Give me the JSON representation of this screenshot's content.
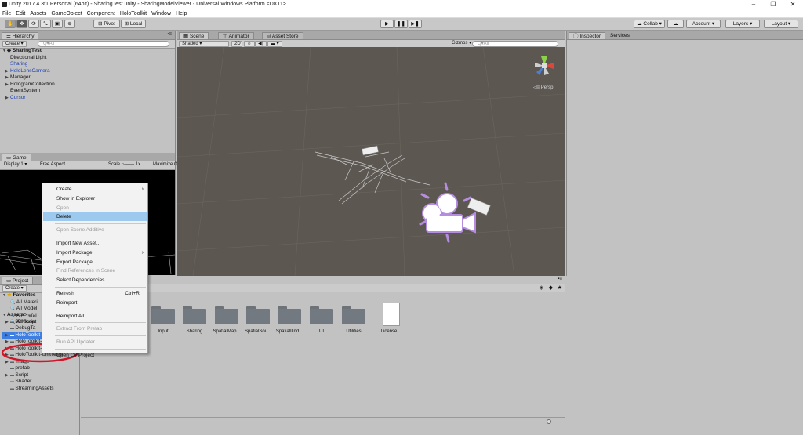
{
  "window": {
    "title": "Unity 2017.4.3f1 Personal (64bit) - SharingTest.unity - SharingModelViewer - Universal Windows Platform <DX11>",
    "controls": [
      "–",
      "❐",
      "✕"
    ]
  },
  "menubar": [
    "File",
    "Edit",
    "Assets",
    "GameObject",
    "Component",
    "HoloToolkit",
    "Window",
    "Help"
  ],
  "toolbar": {
    "pivot": "Pivot",
    "local": "Local",
    "collab": "Collab",
    "account": "Account",
    "layers": "Layers",
    "layout": "Layout"
  },
  "hierarchy": {
    "tab": "Hierarchy",
    "create": "Create",
    "search_placeholder": "Q▾All",
    "scene": "SharingTest",
    "items": [
      {
        "label": "Directional Light",
        "blue": false,
        "arrow": false
      },
      {
        "label": "Sharing",
        "blue": true,
        "arrow": false
      },
      {
        "label": "HoloLensCamera",
        "blue": true,
        "arrow": true
      },
      {
        "label": "Manager",
        "blue": false,
        "arrow": true
      },
      {
        "label": "HologramCollection",
        "blue": false,
        "arrow": true
      },
      {
        "label": "EventSystem",
        "blue": false,
        "arrow": false
      },
      {
        "label": "Cursor",
        "blue": true,
        "arrow": true
      }
    ]
  },
  "game": {
    "tab": "Game",
    "display": "Display 1",
    "aspect": "Free Aspect",
    "scale_label": "Scale",
    "scale_value": "1x",
    "maximize": "Maximize O"
  },
  "scene": {
    "tabs": [
      "Scene",
      "Animator",
      "Asset Store"
    ],
    "shaded": "Shaded",
    "mode_2d": "2D",
    "gizmos": "Gizmos",
    "search_placeholder": "Q▾All",
    "persp": "Persp"
  },
  "inspector": {
    "tabs": [
      "Inspector",
      "Services"
    ]
  },
  "project": {
    "tab": "Project",
    "create": "Create",
    "favorites_label": "Favorites",
    "favorites": [
      "All Materi",
      "All Model",
      "All Prefal",
      "All Script"
    ],
    "assets_label": "Assets",
    "assets": [
      {
        "label": "3DModel",
        "arrow": true
      },
      {
        "label": "DebugTa",
        "arrow": false
      },
      {
        "label": "HoloToolkit",
        "arrow": true,
        "selected": true
      },
      {
        "label": "HoloToolkit-Examples",
        "arrow": true
      },
      {
        "label": "HoloToolkit-Tests",
        "arrow": true
      },
      {
        "label": "HoloToolkit-UnitTests",
        "arrow": true
      },
      {
        "label": "Image",
        "arrow": true
      },
      {
        "label": "prefab",
        "arrow": false
      },
      {
        "label": "Script",
        "arrow": true
      },
      {
        "label": "Shader",
        "arrow": false
      },
      {
        "label": "StreamingAssets",
        "arrow": false
      }
    ],
    "grid_items": [
      "Input",
      "Sharing",
      "SpatialMap...",
      "SpatialSou...",
      "SpatialUnd...",
      "UI",
      "Utilities",
      "License"
    ]
  },
  "context_menu": {
    "items": [
      {
        "label": "Create",
        "submenu": true
      },
      {
        "label": "Show in Explorer"
      },
      {
        "label": "Open",
        "disabled": true
      },
      {
        "label": "Delete",
        "highlighted": true
      },
      {
        "sep": true
      },
      {
        "label": "Open Scene Additive",
        "disabled": true
      },
      {
        "sep": true
      },
      {
        "label": "Import New Asset..."
      },
      {
        "label": "Import Package",
        "submenu": true
      },
      {
        "label": "Export Package..."
      },
      {
        "label": "Find References In Scene",
        "disabled": true
      },
      {
        "label": "Select Dependencies"
      },
      {
        "sep": true
      },
      {
        "label": "Refresh",
        "shortcut": "Ctrl+R"
      },
      {
        "label": "Reimport"
      },
      {
        "sep": true
      },
      {
        "label": "Reimport All"
      },
      {
        "sep": true
      },
      {
        "label": "Extract From Prefab",
        "disabled": true
      },
      {
        "sep": true
      },
      {
        "label": "Run API Updater...",
        "disabled": true
      },
      {
        "sep": true
      },
      {
        "label": "Open C# Project"
      }
    ]
  },
  "colors": {
    "scene_bg": "#5c5751",
    "menu_highlight": "#9ec9ee",
    "annotation_red": "#d0162a",
    "selection_blue": "#3d7ee0"
  }
}
